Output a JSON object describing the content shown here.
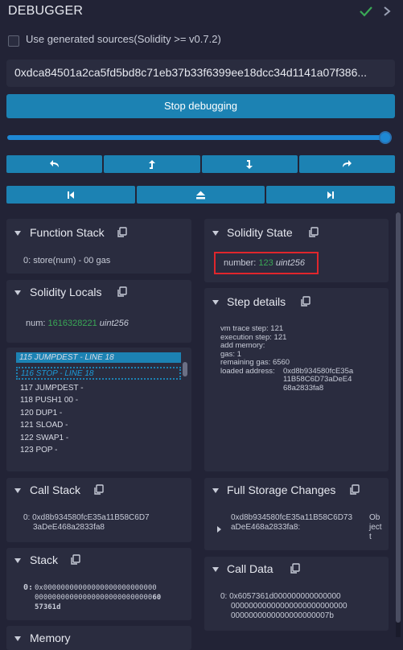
{
  "header": {
    "title": "DEBUGGER"
  },
  "options": {
    "use_generated_label": "Use generated sources(Solidity >= v0.7.2)"
  },
  "tx_hash": "0xdca84501a2ca5fd5bd8c71eb37b33f6399ee18dcc34d1141a07f386...",
  "stop_button": "Stop debugging",
  "slider": {
    "position_fraction": 1.0
  },
  "step_buttons": [
    "step-back-icon",
    "step-into-back-icon",
    "step-into-icon",
    "step-over-icon"
  ],
  "jump_buttons": [
    "jump-previous-breakpoint-icon",
    "jump-out-icon",
    "jump-next-breakpoint-icon"
  ],
  "function_stack": {
    "title": "Function Stack",
    "entry": "0: store(num) - 00 gas"
  },
  "solidity_state": {
    "title": "Solidity State",
    "name": "number:",
    "value": "123",
    "type": "uint256"
  },
  "solidity_locals": {
    "title": "Solidity Locals",
    "name": "num:",
    "value": "1616328221",
    "type": "uint256"
  },
  "opcodes": {
    "items": [
      {
        "num": "115",
        "op": "JUMPDEST",
        "tag": "LINE 18"
      },
      {
        "num": "116",
        "op": "STOP",
        "tag": "LINE 18"
      },
      {
        "text": "117 JUMPDEST -"
      },
      {
        "text": "118 PUSH1 00 -"
      },
      {
        "text": "120 DUP1 -"
      },
      {
        "text": "121 SLOAD -"
      },
      {
        "text": "122 SWAP1 -"
      },
      {
        "text": "123 POP -"
      }
    ]
  },
  "step_details": {
    "title": "Step details",
    "vm_trace_step": "vm trace step: 121",
    "execution_step": "execution step: 121",
    "add_memory": "add memory:",
    "gas": "gas: 1",
    "remaining_gas": "remaining gas: 6560",
    "loaded_address_label": "loaded address:",
    "loaded_address_lines": [
      "0xd8b934580fcE35a",
      "11B58C6D73aDeE4",
      "68a2833fa8"
    ]
  },
  "call_stack": {
    "title": "Call Stack",
    "lines": [
      "0: 0xd8b934580fcE35a11B58C6D7",
      "3aDeE468a2833fa8"
    ]
  },
  "full_storage": {
    "title": "Full Storage Changes",
    "lines": [
      "0xd8b934580fcE35a11B58C6D73",
      "aDeE468a2833fa8:"
    ],
    "type_lines": [
      "Ob",
      "ject",
      "t"
    ]
  },
  "stack": {
    "title": "Stack",
    "index": "0:",
    "lines": [
      "0x00000000000000000000000000",
      "000000000000000000000000000",
      "57361d"
    ],
    "highlight": "60"
  },
  "call_data": {
    "title": "Call Data",
    "lines": [
      "0: 0x6057361d000000000000000",
      "00000000000000000000000000",
      "0000000000000000000007b"
    ]
  },
  "memory": {
    "title": "Memory"
  }
}
